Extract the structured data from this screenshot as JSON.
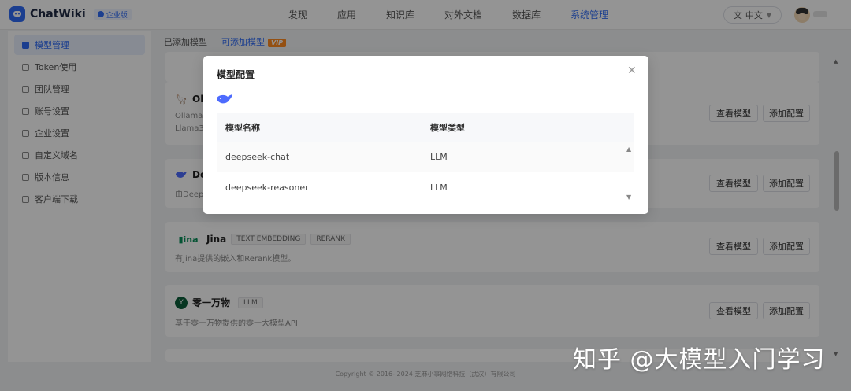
{
  "header": {
    "app_name": "ChatWiki",
    "edition": "企业版",
    "nav": [
      "发现",
      "应用",
      "知识库",
      "对外文档",
      "数据库",
      "系统管理"
    ],
    "active_nav": "系统管理",
    "language": "中文"
  },
  "sidebar": {
    "items": [
      {
        "label": "模型管理",
        "active": true
      },
      {
        "label": "Token使用",
        "active": false
      },
      {
        "label": "团队管理",
        "active": false
      },
      {
        "label": "账号设置",
        "active": false
      },
      {
        "label": "企业设置",
        "active": false
      },
      {
        "label": "自定义域名",
        "active": false
      },
      {
        "label": "版本信息",
        "active": false
      },
      {
        "label": "客户端下载",
        "active": false
      }
    ]
  },
  "tabs": {
    "added": "已添加模型",
    "available": "可添加模型",
    "vip": "VIP"
  },
  "providers": [
    {
      "name": "Olla",
      "desc1": "Ollama",
      "desc2": "Llama3"
    },
    {
      "name": "De",
      "desc1": "由DeepS"
    },
    {
      "name": "Jina",
      "tags": [
        "TEXT EMBEDDING",
        "RERANK"
      ],
      "desc1": "有Jina提供的嵌入和Rerank模型。"
    },
    {
      "name": "零一万物",
      "tags": [
        "LLM"
      ],
      "desc1": "基于零一万物提供的零一大模型API"
    }
  ],
  "buttons": {
    "view": "查看模型",
    "add": "添加配置"
  },
  "footer": "Copyright © 2016- 2024 芝麻小事网络科技（武汉）有限公司",
  "modal": {
    "title": "模型配置",
    "columns": [
      "模型名称",
      "模型类型"
    ],
    "rows": [
      {
        "name": "deepseek-chat",
        "type": "LLM"
      },
      {
        "name": "deepseek-reasoner",
        "type": "LLM"
      }
    ]
  },
  "watermark": "知乎 @大模型入门学习"
}
